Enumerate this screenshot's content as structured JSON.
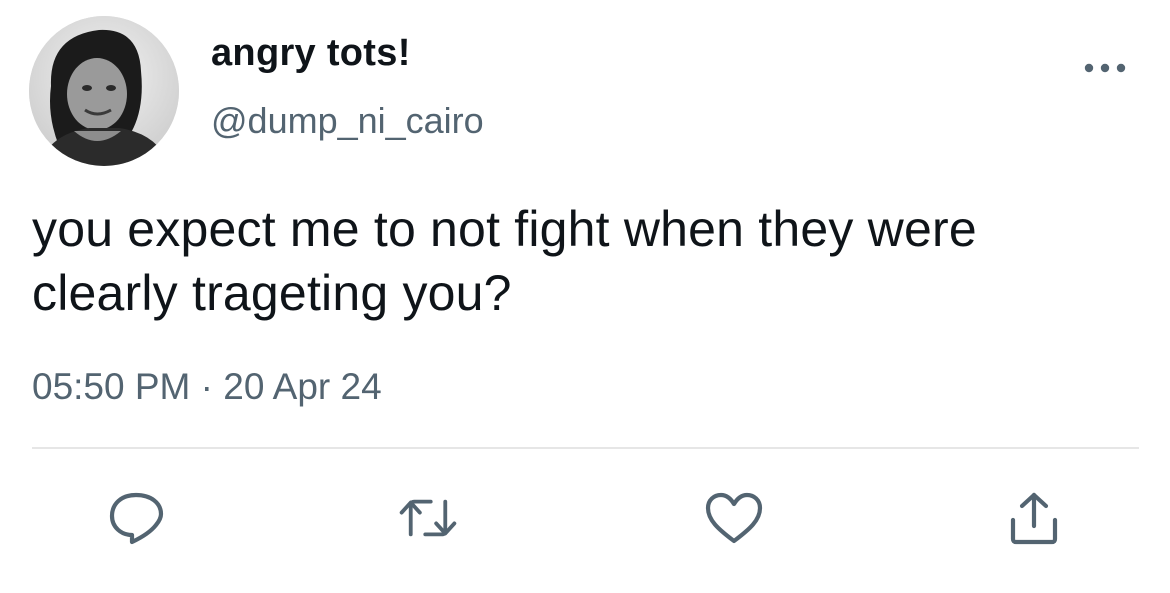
{
  "author": {
    "display_name": "angry tots!",
    "handle": "@dump_ni_cairo"
  },
  "tweet": {
    "text_lines": [
      "you expect me to not fight when they were",
      "clearly trageting you?"
    ],
    "time": "05:50 PM",
    "separator": "·",
    "date": "20 Apr 24"
  },
  "actions": {
    "reply_icon": "reply-icon",
    "retweet_icon": "retweet-icon",
    "like_icon": "heart-icon",
    "share_icon": "share-icon"
  },
  "colors": {
    "text": "#0f1419",
    "secondary": "#536471",
    "divider": "#e6e6e6"
  }
}
